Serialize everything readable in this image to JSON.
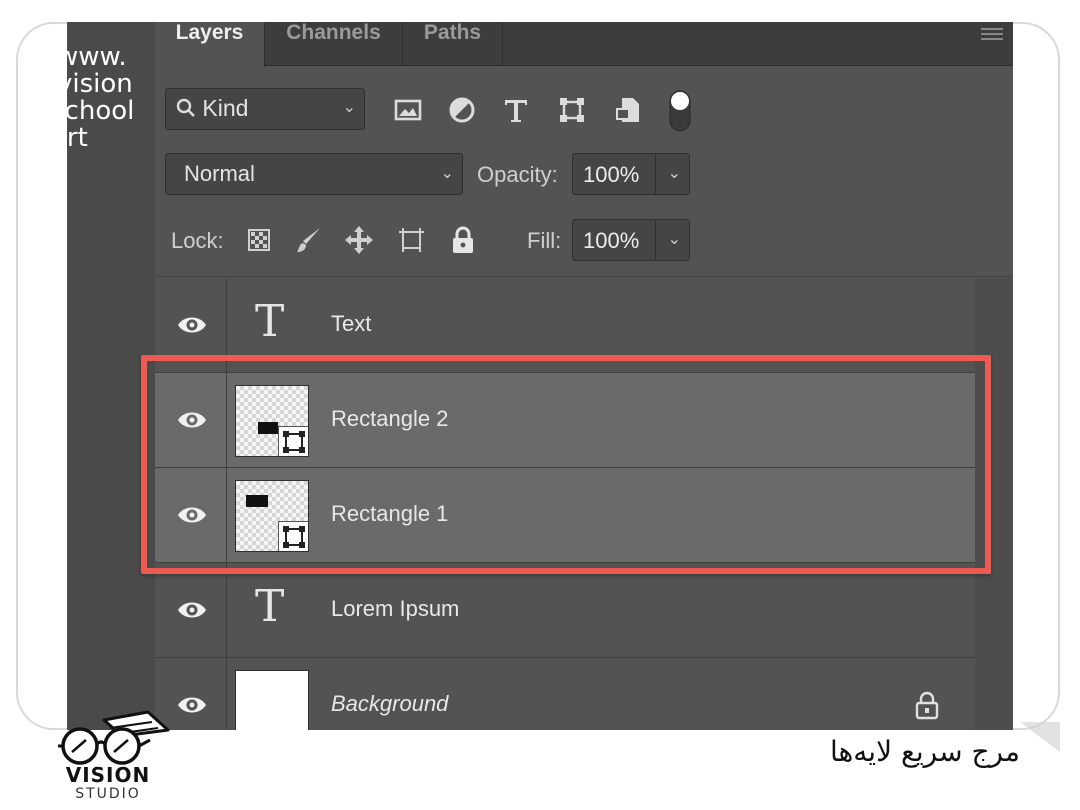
{
  "watermark": {
    "lines": [
      "www.",
      "vision",
      "school",
      "art"
    ]
  },
  "tabs": [
    {
      "label": "Layers",
      "active": true
    },
    {
      "label": "Channels",
      "active": false
    },
    {
      "label": "Paths",
      "active": false
    }
  ],
  "filter": {
    "kind_label": "Kind",
    "icons": [
      "image-filter-icon",
      "adjustment-filter-icon",
      "type-filter-icon",
      "shape-filter-icon",
      "smart-object-filter-icon",
      "filter-toggle-icon"
    ]
  },
  "blend": {
    "mode": "Normal",
    "opacity_label": "Opacity:",
    "opacity_value": "100%"
  },
  "lock": {
    "label": "Lock:",
    "icons": [
      "lock-transparent-icon",
      "lock-pixels-icon",
      "lock-position-icon",
      "lock-artboard-icon",
      "lock-all-icon"
    ],
    "fill_label": "Fill:",
    "fill_value": "100%"
  },
  "layers": [
    {
      "name": "Text",
      "kind": "type",
      "selected": false,
      "icon_glyph": "T"
    },
    {
      "name": "Rectangle 2",
      "kind": "shape",
      "selected": true
    },
    {
      "name": "Rectangle 1",
      "kind": "shape",
      "selected": true
    },
    {
      "name": "Lorem Ipsum",
      "kind": "type",
      "selected": false,
      "icon_glyph": "T"
    },
    {
      "name": "Background",
      "kind": "background",
      "selected": false,
      "locked": true
    }
  ],
  "highlight_color": "#ec5a52",
  "logo": {
    "brand": "VISION",
    "sub": "STUDIO"
  },
  "caption": "مرج سریع لایه‌ها"
}
